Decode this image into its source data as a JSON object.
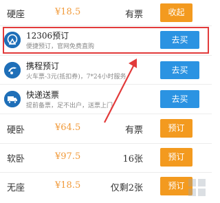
{
  "seats": [
    {
      "name": "硬座",
      "price": "¥18.5",
      "availability": "有票",
      "action": "收起"
    },
    {
      "name": "硬卧",
      "price": "¥64.5",
      "availability": "有票",
      "action": "预订"
    },
    {
      "name": "软卧",
      "price": "¥97.5",
      "availability": "16张",
      "action": "预订"
    },
    {
      "name": "无座",
      "price": "¥18.5",
      "availability": "仅剩2张",
      "action": "预订"
    }
  ],
  "channels": [
    {
      "title": "12306预订",
      "subtitle": "便捷预订，官网免费直购",
      "action": "去买",
      "icon": "12306-logo-icon"
    },
    {
      "title": "携程预订",
      "subtitle": "火车票-3元(抵扣券)，7*24小时服务",
      "action": "去买",
      "icon": "ctrip-icon"
    },
    {
      "title": "快递送票",
      "subtitle": "提前备票，足不出户，送票上门",
      "action": "去买",
      "icon": "delivery-truck-icon"
    }
  ],
  "colors": {
    "orange_button": "#f39a1f",
    "blue_button": "#2b93e2",
    "price": "#f19a3a",
    "highlight_border": "#e23a3a"
  }
}
